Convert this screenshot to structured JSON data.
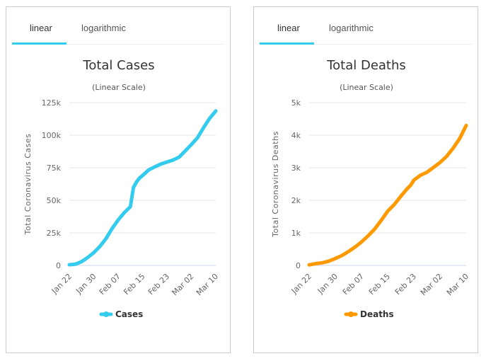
{
  "panels": [
    {
      "tabs": [
        {
          "label": "linear",
          "active": true
        },
        {
          "label": "logarithmic",
          "active": false
        }
      ]
    },
    {
      "tabs": [
        {
          "label": "linear",
          "active": true
        },
        {
          "label": "logarithmic",
          "active": false
        }
      ]
    }
  ],
  "colors": {
    "tab_active": "#33ccee",
    "cases": "#33ccee",
    "deaths": "#ff9900"
  },
  "chart_data": [
    {
      "type": "line",
      "title": "Total Cases",
      "subtitle": "(Linear Scale)",
      "xlabel": "",
      "ylabel": "Total Coronavirus Cases",
      "ylim": [
        0,
        125000
      ],
      "yticks": [
        0,
        25000,
        50000,
        75000,
        100000,
        125000
      ],
      "ytick_labels": [
        "0",
        "25k",
        "50k",
        "75k",
        "100k",
        "125k"
      ],
      "xtick_labels": [
        "Jan 22",
        "Jan 30",
        "Feb 07",
        "Feb 15",
        "Feb 23",
        "Mar 02",
        "Mar 10"
      ],
      "grid": true,
      "legend": "bottom-center",
      "series": [
        {
          "name": "Cases",
          "color": "#33ccee",
          "x_days": [
            0,
            2,
            4,
            6,
            8,
            10,
            12,
            14,
            16,
            18,
            20,
            21,
            22,
            23,
            24,
            26,
            28,
            30,
            32,
            34,
            36,
            38,
            40,
            42,
            44,
            46,
            48
          ],
          "values": [
            555,
            1000,
            2900,
            6100,
            9800,
            14500,
            20600,
            28300,
            34900,
            40500,
            45100,
            59800,
            64000,
            67100,
            69000,
            73300,
            75700,
            77800,
            79400,
            80900,
            83200,
            88000,
            92800,
            98000,
            105800,
            113000,
            118600
          ]
        }
      ]
    },
    {
      "type": "line",
      "title": "Total Deaths",
      "subtitle": "(Linear Scale)",
      "xlabel": "",
      "ylabel": "Total Coronavirus Deaths",
      "ylim": [
        0,
        5000
      ],
      "yticks": [
        0,
        1000,
        2000,
        3000,
        4000,
        5000
      ],
      "ytick_labels": [
        "0",
        "1k",
        "2k",
        "3k",
        "4k",
        "5k"
      ],
      "xtick_labels": [
        "Jan 22",
        "Jan 30",
        "Feb 07",
        "Feb 15",
        "Feb 23",
        "Mar 02",
        "Mar 10"
      ],
      "grid": true,
      "legend": "bottom-center",
      "series": [
        {
          "name": "Deaths",
          "color": "#ff9900",
          "x_days": [
            0,
            2,
            4,
            6,
            8,
            10,
            12,
            14,
            16,
            18,
            20,
            22,
            24,
            26,
            28,
            30,
            31,
            32,
            34,
            36,
            38,
            40,
            42,
            44,
            46,
            48
          ],
          "values": [
            17,
            56,
            80,
            133,
            213,
            304,
            425,
            564,
            722,
            908,
            1113,
            1383,
            1666,
            1870,
            2122,
            2360,
            2460,
            2620,
            2770,
            2860,
            3010,
            3160,
            3350,
            3600,
            3900,
            4300
          ]
        }
      ]
    }
  ]
}
